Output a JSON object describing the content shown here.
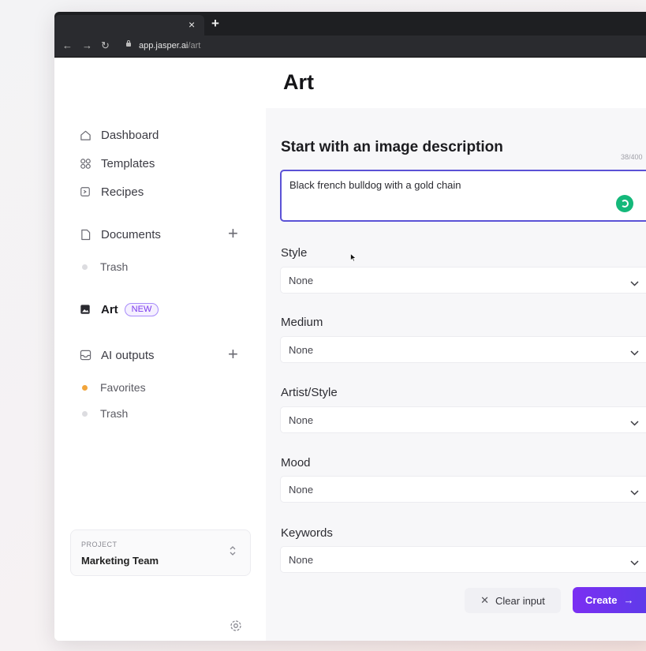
{
  "browser": {
    "tab_close": "×",
    "new_tab": "+",
    "url_host": "app.jasper.ai",
    "url_path": "/art"
  },
  "sidebar": {
    "items": [
      {
        "label": "Dashboard",
        "icon": "home-icon"
      },
      {
        "label": "Templates",
        "icon": "grid-icon"
      },
      {
        "label": "Recipes",
        "icon": "recipe-icon"
      },
      {
        "label": "Documents",
        "icon": "document-icon"
      },
      {
        "label": "Trash",
        "icon": "dot"
      },
      {
        "label": "Art",
        "icon": "image-icon",
        "badge": "NEW"
      },
      {
        "label": "AI outputs",
        "icon": "inbox-icon"
      },
      {
        "label": "Favorites",
        "icon": "dot-orange"
      },
      {
        "label": "Trash",
        "icon": "dot"
      }
    ],
    "project": {
      "caption": "PROJECT",
      "name": "Marketing Team"
    }
  },
  "main": {
    "title": "Art",
    "section_title": "Start with an image description",
    "counter": "38/400",
    "description_value": "Black french bulldog with a gold chain",
    "fields": [
      {
        "label": "Style",
        "value": "None"
      },
      {
        "label": "Medium",
        "value": "None"
      },
      {
        "label": "Artist/Style",
        "value": "None"
      },
      {
        "label": "Mood",
        "value": "None"
      },
      {
        "label": "Keywords",
        "value": "None"
      }
    ],
    "clear_label": "Clear input",
    "create_label": "Create"
  },
  "colors": {
    "accent": "#5b52d6",
    "create_button": "#6c35ef",
    "new_badge": "#7c3aed",
    "spinner": "#14b87a",
    "favorites_dot": "#f2a53b"
  }
}
